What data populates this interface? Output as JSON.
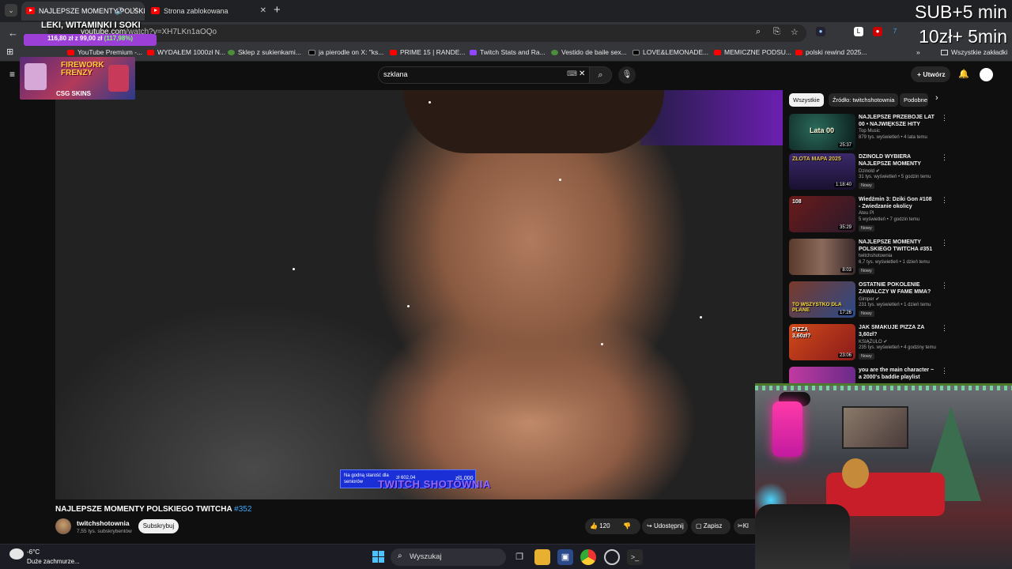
{
  "browser": {
    "tabs": [
      {
        "title": "NAJLEPSZE MOMENTY POLSKIEGO TWITCHA #352 - YouTube",
        "active": true
      },
      {
        "title": "Strona zablokowana",
        "active": false
      }
    ],
    "new_tab_icon": "plus-icon",
    "url_domain": "youtube.com",
    "url_path": "/watch?v=XH7LKn1aOQo",
    "bookmarks": [
      {
        "label": "YouTube Premium -...",
        "icon": "youtube"
      },
      {
        "label": "WYDAŁEM 1000zł N...",
        "icon": "youtube"
      },
      {
        "label": "Sklep z sukienkami...",
        "icon": "globe"
      },
      {
        "label": "ja pierodle on X: \"ks...",
        "icon": "x"
      },
      {
        "label": "PRIME 15 | RANDE...",
        "icon": "youtube"
      },
      {
        "label": "Twitch Stats and Ra...",
        "icon": "twitch"
      },
      {
        "label": "Vestido de baile sex...",
        "icon": "globe"
      },
      {
        "label": "LOVE&LEMONADE...",
        "icon": "shop"
      },
      {
        "label": "MEMICZNE PODSU...",
        "icon": "youtube"
      },
      {
        "label": "polski rewind 2025...",
        "icon": "youtube"
      }
    ],
    "all_bookmarks_label": "Wszystkie zakładki"
  },
  "youtube": {
    "search_value": "szklana",
    "create_label": "Utwórz",
    "video": {
      "title": "NAJLEPSZE MOMENTY POLSKIEGO TWITCHA",
      "hashtag": "#352",
      "channel": "twitchshotownia",
      "subscribers": "7,55 tys. subskrybentów",
      "subscribe_label": "Subskrybuj",
      "likes": "120",
      "share_label": "Udostępnij",
      "save_label": "Zapisz",
      "clip_label": "Kl",
      "donation_left": "Na godną starość dla seniorów",
      "donation_amount": "zł 602,04",
      "donation_goal": "zł1,000",
      "watermark": "TWITCH SHOTOWNIA"
    },
    "chips": [
      "Wszystkie",
      "Źródło: twitchshotownia",
      "Podobne"
    ],
    "recommendations": [
      {
        "title": "NAJLEPSZE PRZEBOJE LAT 00 • NAJWIĘKSZE HITY TAMTYCH...",
        "channel": "Top Music",
        "meta": "879 tys. wyświetleń • 4 lata temu",
        "duration": "25:37",
        "badge": "",
        "thumb_text": "Lata 00"
      },
      {
        "title": "DZINOLD WYBIERA NAJLEPSZE MOMENTY POLSKICH ...",
        "channel": "Dzinold",
        "meta": "31 tys. wyświetleń • 5 godzin temu",
        "duration": "1:18:40",
        "badge": "Nowy",
        "thumb_text": "ZŁOTA MAPA 2025"
      },
      {
        "title": "Wiedźmin 3: Dziki Gon #108 - Zwiedzanie okolicy",
        "channel": "Ateu Pl",
        "meta": "5 wyświetleń • 7 godzin temu",
        "duration": "35:29",
        "badge": "Nowy",
        "thumb_text": "108"
      },
      {
        "title": "NAJLEPSZE MOMENTY POLSKIEGO TWITCHA #351",
        "channel": "twitchshotownia",
        "meta": "6,7 tys. wyświetleń • 1 dzień temu",
        "duration": "8:03",
        "badge": "Nowy",
        "thumb_text": ""
      },
      {
        "title": "OSTATNIE POKOLENIE ZAWALCZY W FAME MMA? xD",
        "channel": "Gimper",
        "meta": "231 tys. wyświetleń • 1 dzień temu",
        "duration": "17:26",
        "badge": "Nowy",
        "thumb_text": "TO WSZYSTKO DLA PLANE"
      },
      {
        "title": "JAK SMAKUJE PIZZA ZA 3,60zł?",
        "channel": "KSIĄŻULO",
        "meta": "235 tys. wyświetleń • 4 godziny temu",
        "duration": "23:06",
        "badge": "Nowy",
        "thumb_text": "PIZZA 3,60zł?"
      },
      {
        "title": "you are the main character ~ a 2000's baddie playlist",
        "channel": "",
        "meta": "",
        "duration": "",
        "badge": "",
        "thumb_text": ""
      }
    ]
  },
  "stream_overlay": {
    "sub_line1": "SUB+5 min",
    "sub_line2": "10zł+ 5min",
    "goal_title": "LEKI, WITAMINKI I SOKI",
    "goal_text": "116,80 zł z 99,00 zł",
    "goal_pct_text": "(117,98%)",
    "goal_fraction": 1.0,
    "promo_title": "FIREWORK FRENZY",
    "promo_brand": "CSG SKINS"
  },
  "taskbar": {
    "temperature": "-6°C",
    "weather": "Duże zachmurze...",
    "search_placeholder": "Wyszukaj"
  },
  "colors": {
    "accent_link": "#3ea6ff",
    "youtube_red": "#ff0000",
    "goal_purple": "#9b3fd6",
    "windows_blue": "#4cc2ff"
  }
}
